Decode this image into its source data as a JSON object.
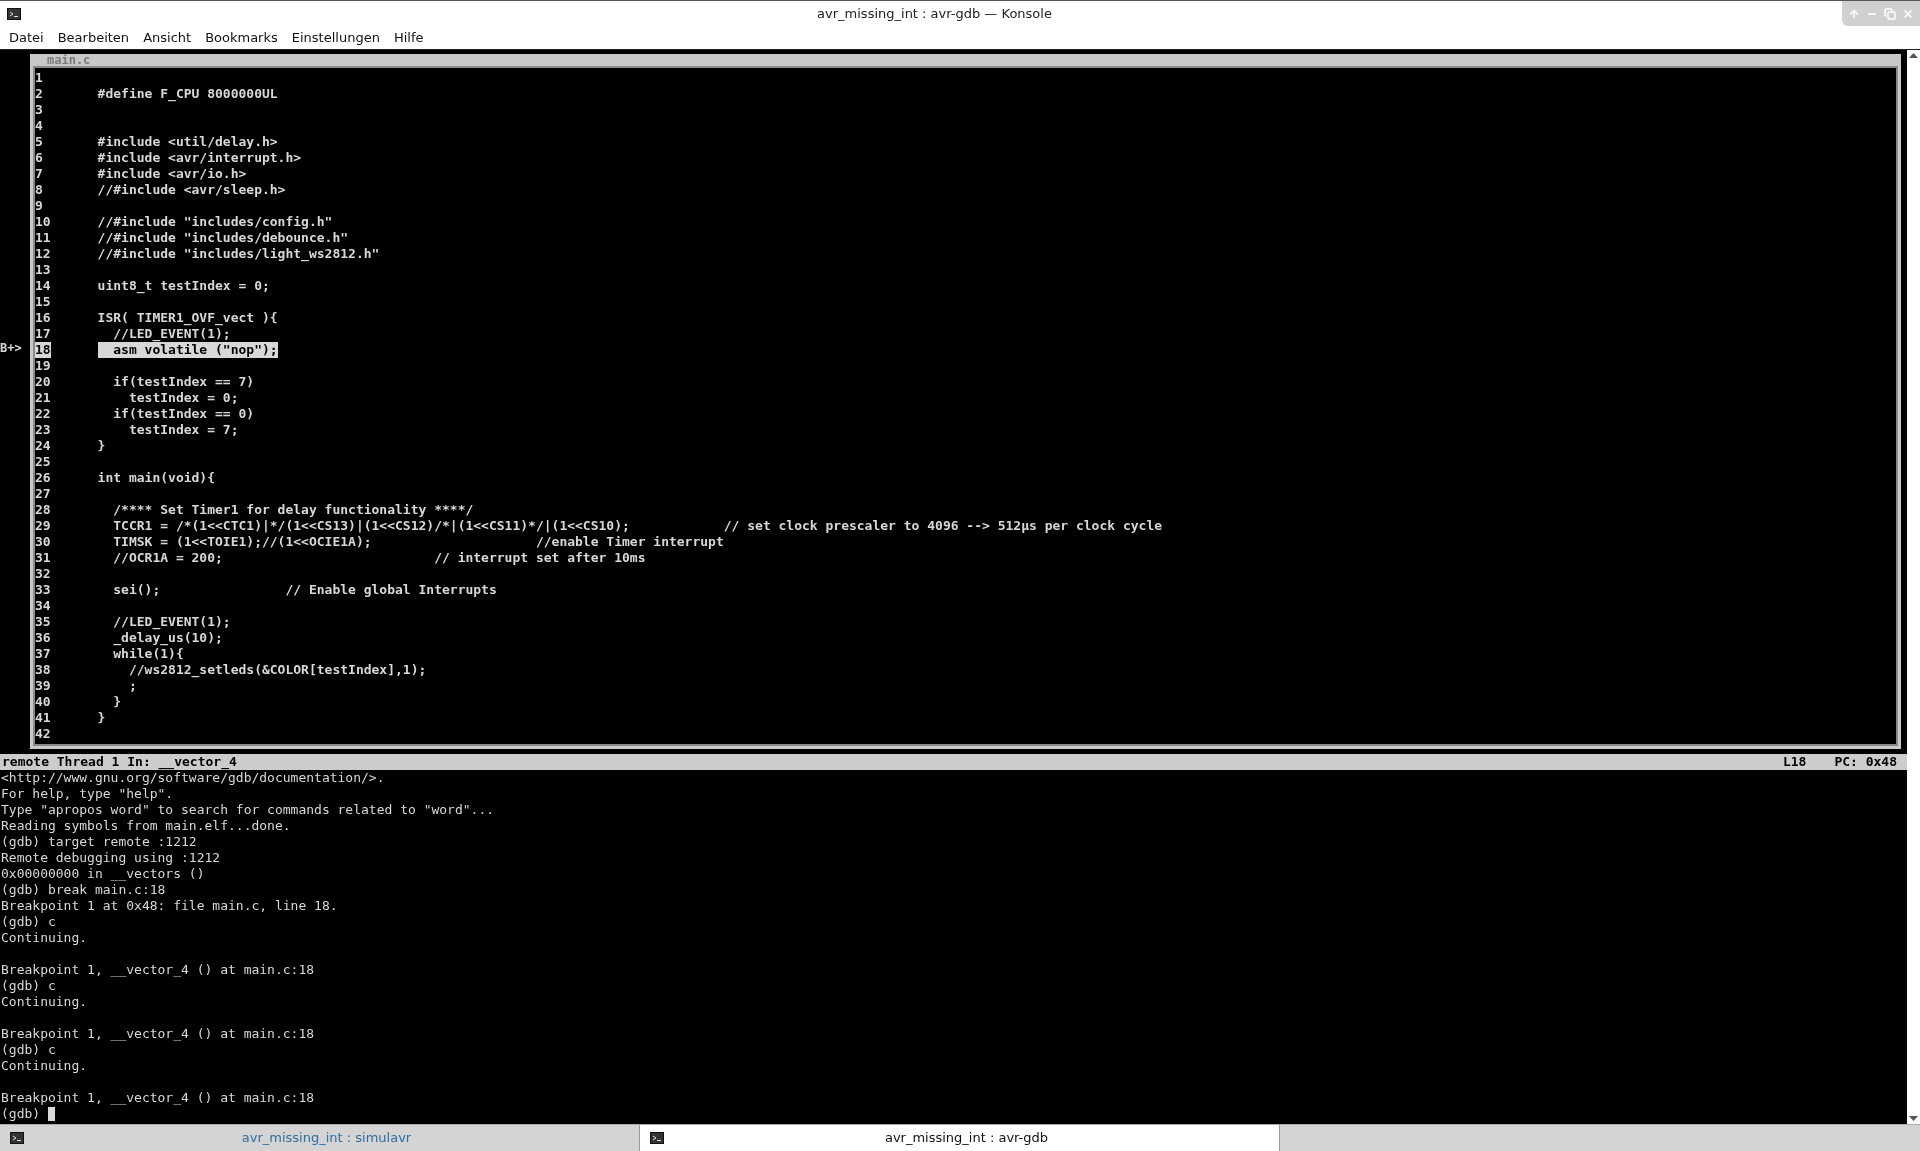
{
  "window": {
    "title": "avr_missing_int : avr-gdb — Konsole"
  },
  "menu": [
    "Datei",
    "Bearbeiten",
    "Ansicht",
    "Bookmarks",
    "Einstellungen",
    "Hilfe"
  ],
  "source": {
    "title": "main.c",
    "lines": [
      {
        "number": "1",
        "selected": false
      },
      {
        "number": "2",
        "text": "#define F_CPU 8000000UL",
        "selected": false
      },
      {
        "number": "3",
        "selected": false
      },
      {
        "number": "4",
        "selected": false
      },
      {
        "number": "5",
        "text": "#include <util/delay.h>",
        "selected": false
      },
      {
        "number": "6",
        "text": "#include <avr/interrupt.h>",
        "selected": false
      },
      {
        "number": "7",
        "text": "#include <avr/io.h>",
        "selected": false
      },
      {
        "number": "8",
        "text": "//#include <avr/sleep.h>",
        "selected": false
      },
      {
        "number": "9",
        "selected": false
      },
      {
        "number": "10",
        "text": "//#include \"includes/config.h\"",
        "selected": false
      },
      {
        "number": "11",
        "text": "//#include \"includes/debounce.h\"",
        "selected": false
      },
      {
        "number": "12",
        "text": "//#include \"includes/light_ws2812.h\"",
        "selected": false
      },
      {
        "number": "13",
        "selected": false
      },
      {
        "number": "14",
        "text": "uint8_t testIndex = 0;",
        "selected": false
      },
      {
        "number": "15",
        "selected": false
      },
      {
        "number": "16",
        "text": "ISR( TIMER1_OVF_vect ){",
        "selected": false
      },
      {
        "number": "17",
        "text": "  //LED_EVENT(1);",
        "selected": false
      },
      {
        "number": "18",
        "text": "  asm volatile (\"nop\");",
        "selected": true,
        "marker": "B+>"
      },
      {
        "number": "19",
        "selected": false
      },
      {
        "number": "20",
        "text": "  if(testIndex == 7)",
        "selected": false
      },
      {
        "number": "21",
        "text": "    testIndex = 0;",
        "selected": false
      },
      {
        "number": "22",
        "text": "  if(testIndex == 0)",
        "selected": false
      },
      {
        "number": "23",
        "text": "    testIndex = 7;",
        "selected": false
      },
      {
        "number": "24",
        "text": "}",
        "selected": false
      },
      {
        "number": "25",
        "selected": false
      },
      {
        "number": "26",
        "text": "int main(void){",
        "selected": false
      },
      {
        "number": "27",
        "selected": false
      },
      {
        "number": "28",
        "text": "  /**** Set Timer1 for delay functionality ****/",
        "selected": false
      },
      {
        "number": "29",
        "text": "  TCCR1 = /*(1<<CTC1)|*/(1<<CS13)|(1<<CS12)/*|(1<<CS11)*/|(1<<CS10);            // set clock prescaler to 4096 --> 512µs per clock cycle",
        "selected": false
      },
      {
        "number": "30",
        "text": "  TIMSK = (1<<TOIE1);//(1<<OCIE1A);                     //enable Timer interrupt",
        "selected": false
      },
      {
        "number": "31",
        "text": "  //OCR1A = 200;                           // interrupt set after 10ms",
        "selected": false
      },
      {
        "number": "32",
        "selected": false
      },
      {
        "number": "33",
        "text": "  sei();                // Enable global Interrupts",
        "selected": false
      },
      {
        "number": "34",
        "selected": false
      },
      {
        "number": "35",
        "text": "  //LED_EVENT(1);",
        "selected": false
      },
      {
        "number": "36",
        "text": "  _delay_us(10);",
        "selected": false
      },
      {
        "number": "37",
        "text": "  while(1){",
        "selected": false
      },
      {
        "number": "38",
        "text": "    //ws2812_setleds(&COLOR[testIndex],1);",
        "selected": false
      },
      {
        "number": "39",
        "text": "    ;",
        "selected": false
      },
      {
        "number": "40",
        "text": "  }",
        "selected": false
      },
      {
        "number": "41",
        "text": "}",
        "selected": false
      },
      {
        "number": "42",
        "selected": false
      }
    ]
  },
  "status_bar": {
    "location": "remote Thread 1 In: __vector_4",
    "line": "L18",
    "pc": "PC: 0x48"
  },
  "console": {
    "blocks": [
      [
        "<http://www.gnu.org/software/gdb/documentation/>.",
        "For help, type \"help\".",
        "Type \"apropos word\" to search for commands related to \"word\"...",
        "Reading symbols from main.elf...done.",
        "(gdb) target remote :1212",
        "Remote debugging using :1212",
        "0x00000000 in __vectors ()",
        "(gdb) break main.c:18",
        "Breakpoint 1 at 0x48: file main.c, line 18.",
        "(gdb) c",
        "Continuing."
      ],
      [
        "Breakpoint 1, __vector_4 () at main.c:18",
        "(gdb) c",
        "Continuing."
      ],
      [
        "Breakpoint 1, __vector_4 () at main.c:18",
        "(gdb) c",
        "Continuing."
      ],
      [
        "Breakpoint 1, __vector_4 () at main.c:18"
      ]
    ],
    "prompt": "(gdb)"
  },
  "tabs": [
    {
      "label": "avr_missing_int : simulavr",
      "selected": false
    },
    {
      "label": "avr_missing_int : avr-gdb",
      "selected": true
    }
  ]
}
